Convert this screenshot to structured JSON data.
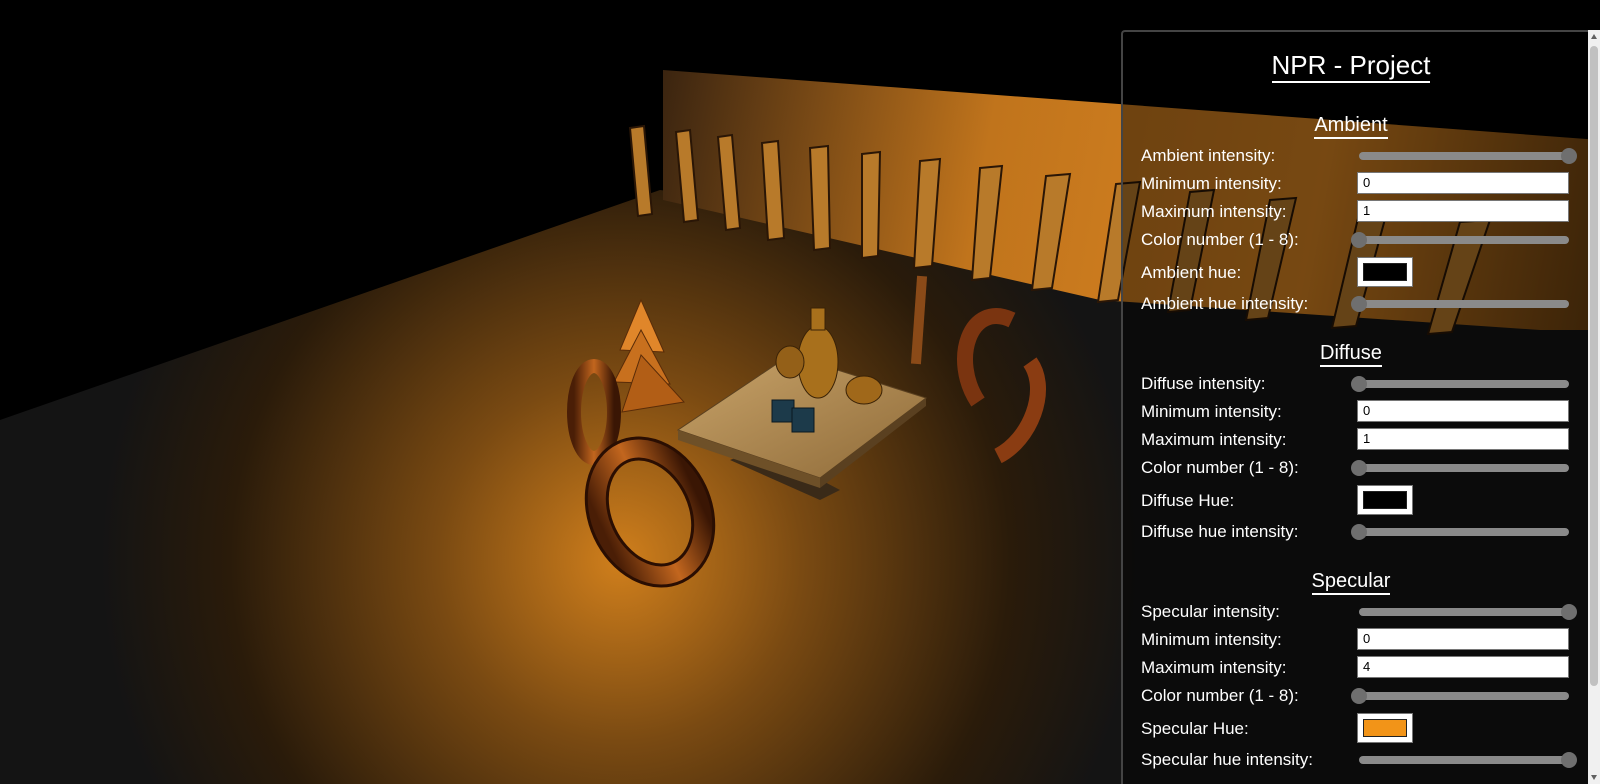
{
  "panel": {
    "title": "NPR - Project",
    "sections": [
      {
        "title": "Ambient",
        "intensity_label": "Ambient intensity:",
        "intensity_value": 1.0,
        "min_label": "Minimum intensity:",
        "min_value": "0",
        "max_label": "Maximum intensity:",
        "max_value": "1",
        "color_number_label": "Color number (1 - 8):",
        "color_number_value": 1,
        "hue_label": "Ambient hue:",
        "hue_color": "#000000",
        "hue_intensity_label": "Ambient hue intensity:",
        "hue_intensity_value": 0.0
      },
      {
        "title": "Diffuse",
        "intensity_label": "Diffuse intensity:",
        "intensity_value": 0.0,
        "min_label": "Minimum intensity:",
        "min_value": "0",
        "max_label": "Maximum intensity:",
        "max_value": "1",
        "color_number_label": "Color number (1 - 8):",
        "color_number_value": 1,
        "hue_label": "Diffuse Hue:",
        "hue_color": "#000000",
        "hue_intensity_label": "Diffuse hue intensity:",
        "hue_intensity_value": 0.0
      },
      {
        "title": "Specular",
        "intensity_label": "Specular intensity:",
        "intensity_value": 1.0,
        "min_label": "Minimum intensity:",
        "min_value": "0",
        "max_label": "Maximum intensity:",
        "max_value": "4",
        "color_number_label": "Color number (1 - 8):",
        "color_number_value": 1,
        "hue_label": "Specular Hue:",
        "hue_color": "#f29418",
        "hue_intensity_label": "Specular hue intensity:",
        "hue_intensity_value": 1.0
      }
    ]
  },
  "colors": {
    "light_accent": "#e08a20",
    "object_copper": "#b8601a",
    "cube_teal": "#1c3a4a"
  }
}
